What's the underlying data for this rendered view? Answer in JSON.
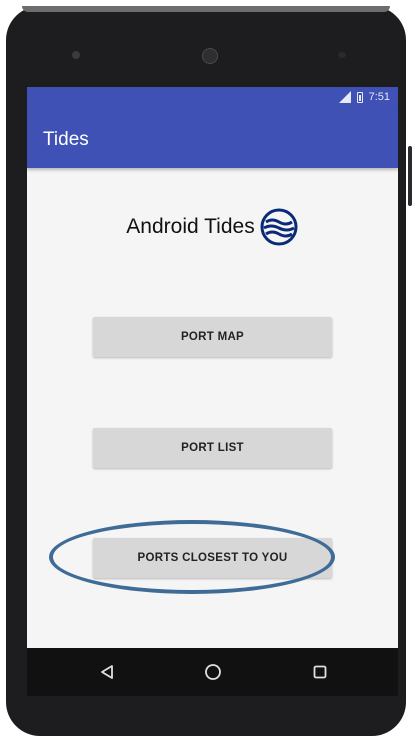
{
  "status_bar": {
    "time": "7:51"
  },
  "app_bar": {
    "title": "Tides"
  },
  "logo": {
    "text": "Android Tides"
  },
  "buttons": {
    "port_map": "PORT MAP",
    "port_list": "PORT LIST",
    "ports_closest": "PORTS CLOSEST TO YOU"
  },
  "nav_bar": {
    "back_icon": "back-icon",
    "home_icon": "home-icon",
    "recents_icon": "recents-icon"
  },
  "colors": {
    "primary": "#3f51b5",
    "button": "#d7d7d7",
    "logo_blue": "#0a2a78",
    "highlight_ring": "#3f6b97"
  }
}
